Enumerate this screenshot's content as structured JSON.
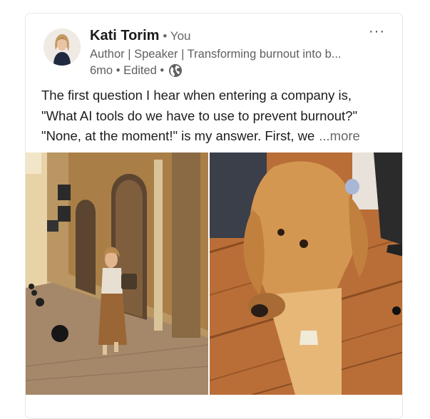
{
  "post": {
    "author": {
      "name": "Kati Torim",
      "relation": "• You",
      "headline": "Author | Speaker | Transforming burnout into b...",
      "time": "6mo",
      "edited": "• Edited •",
      "visibility_icon": "globe-icon"
    },
    "menu_label": "···",
    "text_lines": [
      "The first question I hear when entering a company is,",
      "\"What AI tools do we have to use to prevent burnout?\"",
      "\"None, at the moment!\" is my answer. First, we"
    ],
    "see_more": "...more",
    "images": [
      "street-photo-woman",
      "golden-retriever-photo"
    ]
  }
}
